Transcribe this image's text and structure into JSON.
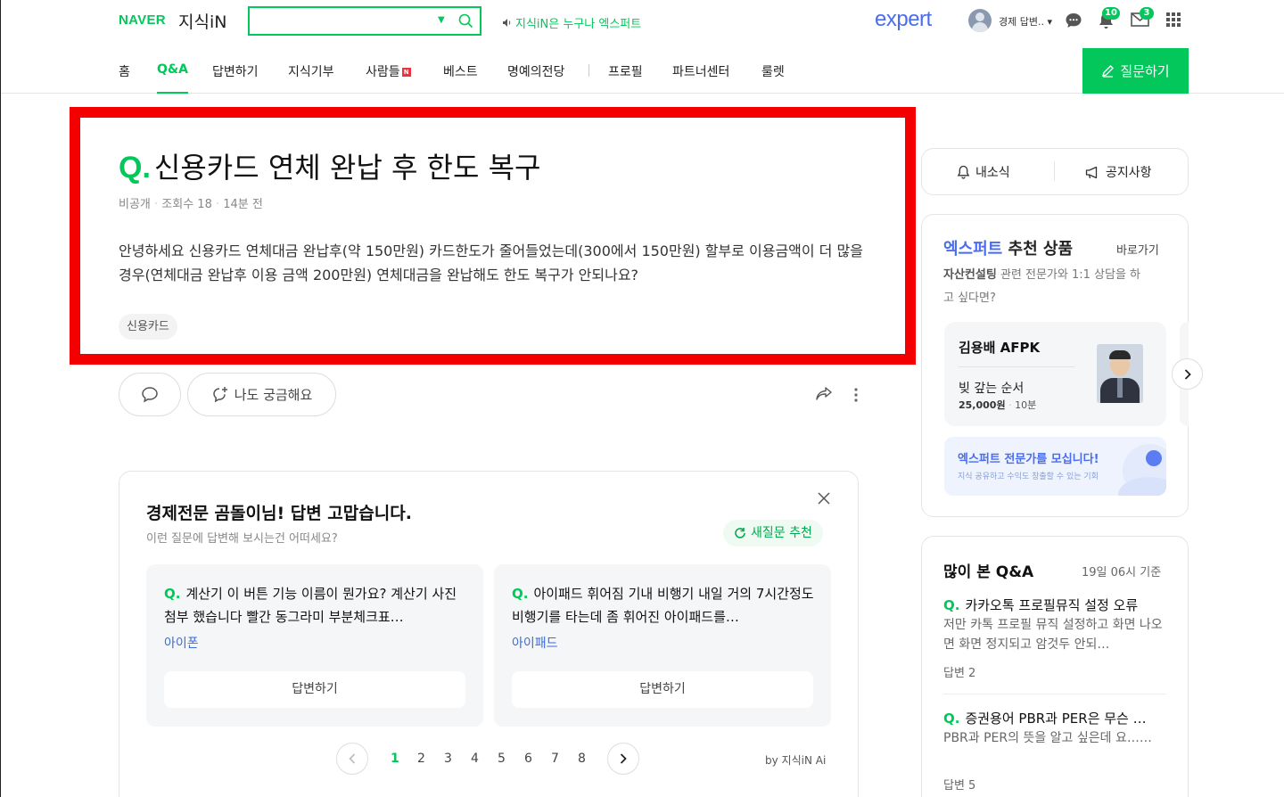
{
  "header": {
    "logo_naver": "NAVER",
    "logo_service": "지식iN",
    "search_placeholder": "",
    "slogan": "지식iN은 누구나 엑스퍼트",
    "expert_logo": "expert",
    "user_name": "경제 답변.. ▾",
    "notifications_count": "10",
    "messages_count": "3",
    "icons": [
      "search-icon",
      "speaker-icon",
      "chat-icon",
      "bell-icon",
      "mail-icon",
      "apps-grid-icon"
    ]
  },
  "nav": {
    "items": [
      "홈",
      "Q&A",
      "답변하기",
      "지식기부",
      "사람들",
      "베스트",
      "명예의전당",
      "프로필",
      "파트너센터",
      "룰렛"
    ],
    "active": "Q&A",
    "new_badge": "N",
    "ask_button": "질문하기"
  },
  "question": {
    "mark": "Q.",
    "title": "신용카드 연체 완납 후 한도 복구",
    "visibility": "비공개",
    "views": "조회수 18",
    "time": "14분 전",
    "body": "안녕하세요 신용카드 연체대금 완납후(약 150만원) 카드한도가 줄어들었는데(300에서 150만원) 할부로 이용금액이 더 많을 경우(연체대금 완납후 이용 금액 200만원) 연체대금을 완납해도 한도 복구가 안되나요?",
    "tag": "신용카드",
    "curious_button": "나도 궁금해요"
  },
  "suggestions": {
    "title": "경제전문 곰돌이님! 답변 고맙습니다.",
    "subtitle": "이런 질문에 답변해 보시는건 어떠세요?",
    "new_button": "새질문 추천",
    "cards": [
      {
        "text": "계산기 이 버튼 기능 이름이 뭔가요? 계산기 사진 첨부 했습니다 빨간 동그라미 부분체크표…",
        "tag": "아이폰",
        "button": "답변하기"
      },
      {
        "text": "아이패드 휘어짐 기내 비행기 내일 거의 7시간정도 비행기를 타는데 좀 휘어진 아이패드를…",
        "tag": "아이패드",
        "button": "답변하기"
      }
    ],
    "pages": [
      "1",
      "2",
      "3",
      "4",
      "5",
      "6",
      "7",
      "8"
    ],
    "active_page": "1",
    "by_label": "by 지식iN Ai"
  },
  "sidebar": {
    "my_news": "내소식",
    "notice": "공지사항",
    "expert_title_accent": "엑스퍼트",
    "expert_title_rest": " 추천 상품",
    "expert_link": "바로가기",
    "expert_desc_bold": "자산컨설팅",
    "expert_desc_line1_rest": " 관련 전문가와 1:1 상담을 하",
    "expert_desc_line2": "고 싶다면?",
    "expert_name": "김용배 AFPK",
    "product_name": "빚 갚는 순서",
    "price": "25,000원",
    "duration": "10분",
    "banner_title": "엑스퍼트 전문가를 모십니다!",
    "banner_sub": "지식 공유하고 수익도 창출할 수 있는 기회",
    "most_viewed_title": "많이 본 Q&A",
    "most_viewed_time": "19일 06시 기준",
    "most_viewed": [
      {
        "title": "카카오톡 프로필뮤직 설정 오류",
        "body": "저만 카톡 프로필 뮤직 설정하고 화면 나오면 화면 정지되고 암것두 안되…",
        "answers": "답변 2"
      },
      {
        "title": "증권용어 PBR과 PER은 무슨 …",
        "body": "PBR과 PER의 뜻을 알고 싶은데 요……",
        "answers": "답변 5"
      }
    ]
  },
  "colors": {
    "brand_green": "#03c75a",
    "expert_blue": "#4a6cf0",
    "highlight_red": "#f50000"
  }
}
